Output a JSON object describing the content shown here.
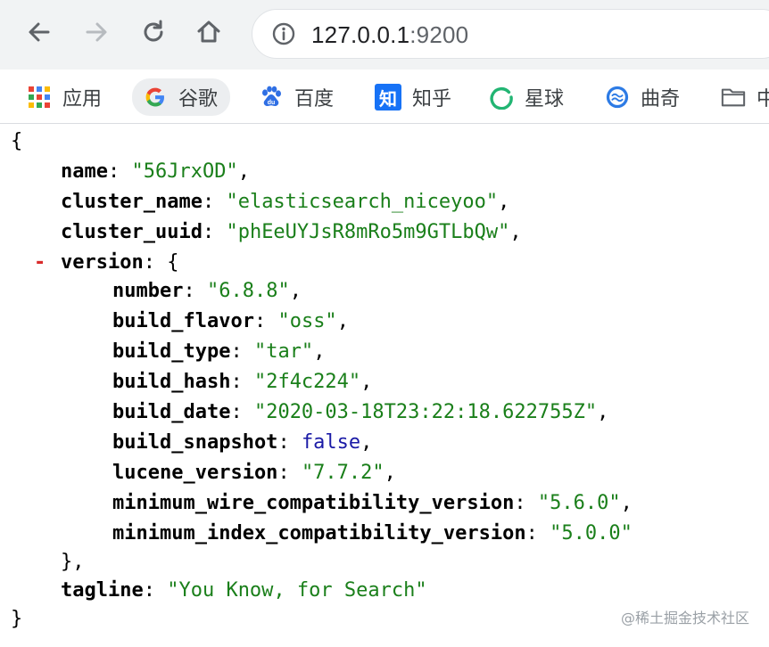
{
  "browser": {
    "url_host": "127.0.0.1",
    "url_port": ":9200",
    "icons": {
      "back": "arrow-left-icon",
      "forward": "arrow-right-icon",
      "reload": "reload-icon",
      "home": "home-icon",
      "info": "info-icon"
    }
  },
  "bookmarks": [
    {
      "label": "应用",
      "icon": "apps-grid-icon"
    },
    {
      "label": "谷歌",
      "icon": "google-icon"
    },
    {
      "label": "百度",
      "icon": "baidu-paw-icon"
    },
    {
      "label": "知乎",
      "icon": "zhihu-icon",
      "icon_text": "知"
    },
    {
      "label": "星球",
      "icon": "ring-icon"
    },
    {
      "label": "曲奇",
      "icon": "cookie-circle-icon"
    },
    {
      "label": "中",
      "icon": "folder-icon"
    }
  ],
  "json": {
    "open_brace": "{",
    "close_brace": "}",
    "collapse_marker": "-",
    "name": {
      "key": "name",
      "value": "\"56JrxOD\""
    },
    "cluster_name": {
      "key": "cluster_name",
      "value": "\"elasticsearch_niceyoo\""
    },
    "cluster_uuid": {
      "key": "cluster_uuid",
      "value": "\"phEeUYJsR8mRo5m9GTLbQw\""
    },
    "version_key": "version",
    "version": {
      "number": {
        "key": "number",
        "value": "\"6.8.8\""
      },
      "build_flavor": {
        "key": "build_flavor",
        "value": "\"oss\""
      },
      "build_type": {
        "key": "build_type",
        "value": "\"tar\""
      },
      "build_hash": {
        "key": "build_hash",
        "value": "\"2f4c224\""
      },
      "build_date": {
        "key": "build_date",
        "value": "\"2020-03-18T23:22:18.622755Z\""
      },
      "build_snapshot": {
        "key": "build_snapshot",
        "value": "false"
      },
      "lucene_version": {
        "key": "lucene_version",
        "value": "\"7.7.2\""
      },
      "minimum_wire_compatibility_version": {
        "key": "minimum_wire_compatibility_version",
        "value": "\"5.6.0\""
      },
      "minimum_index_compatibility_version": {
        "key": "minimum_index_compatibility_version",
        "value": "\"5.0.0\""
      }
    },
    "version_close": "},",
    "tagline": {
      "key": "tagline",
      "value": "\"You Know, for Search\""
    }
  },
  "watermark": "@稀土掘金技术社区",
  "colors": {
    "string": "#1a7f1a",
    "boolean": "#1a1aa6",
    "collapse": "#d92b2b",
    "toolbar_bg": "#f1f3f4"
  }
}
